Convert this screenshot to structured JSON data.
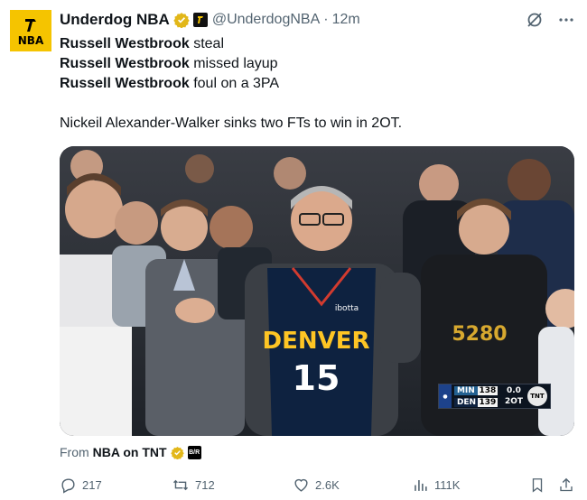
{
  "author": {
    "avatar_label": "NBA",
    "name": "Underdog NBA",
    "handle": "@UnderdogNBA",
    "separator": "·",
    "time": "12m"
  },
  "tweet": {
    "lines": [
      {
        "player": "Russell Westbrook",
        "action": "steal"
      },
      {
        "player": "Russell Westbrook",
        "action": "missed layup"
      },
      {
        "player": "Russell Westbrook",
        "action": "foul on a 3PA"
      }
    ],
    "summary": "Nickeil Alexander-Walker sinks two FTs to win in 2OT."
  },
  "media": {
    "jersey_team": "DENVER",
    "jersey_number": "15",
    "jersey_patch": "ibotta",
    "scoreboard": {
      "team1": "MIN",
      "score1": "138",
      "team2": "DEN",
      "score2": "139",
      "clock": "0.0",
      "period": "2OT",
      "network": "TNT"
    }
  },
  "source": {
    "prefix": "From",
    "name": "NBA on TNT",
    "badge": "B/R"
  },
  "stats": {
    "replies": "217",
    "retweets": "712",
    "likes": "2.6K",
    "views": "111K"
  },
  "icons": [
    "underdog-logo-icon",
    "verified-badge-icon",
    "grok-icon",
    "more-icon",
    "reply-icon",
    "retweet-icon",
    "like-icon",
    "views-icon",
    "bookmark-icon",
    "share-icon"
  ],
  "colors": {
    "avatar_bg": "#f5c400",
    "verified_gold": "#e2b719",
    "muted_text": "#536471",
    "jersey_navy": "#0e2240",
    "jersey_gold": "#fec524"
  }
}
